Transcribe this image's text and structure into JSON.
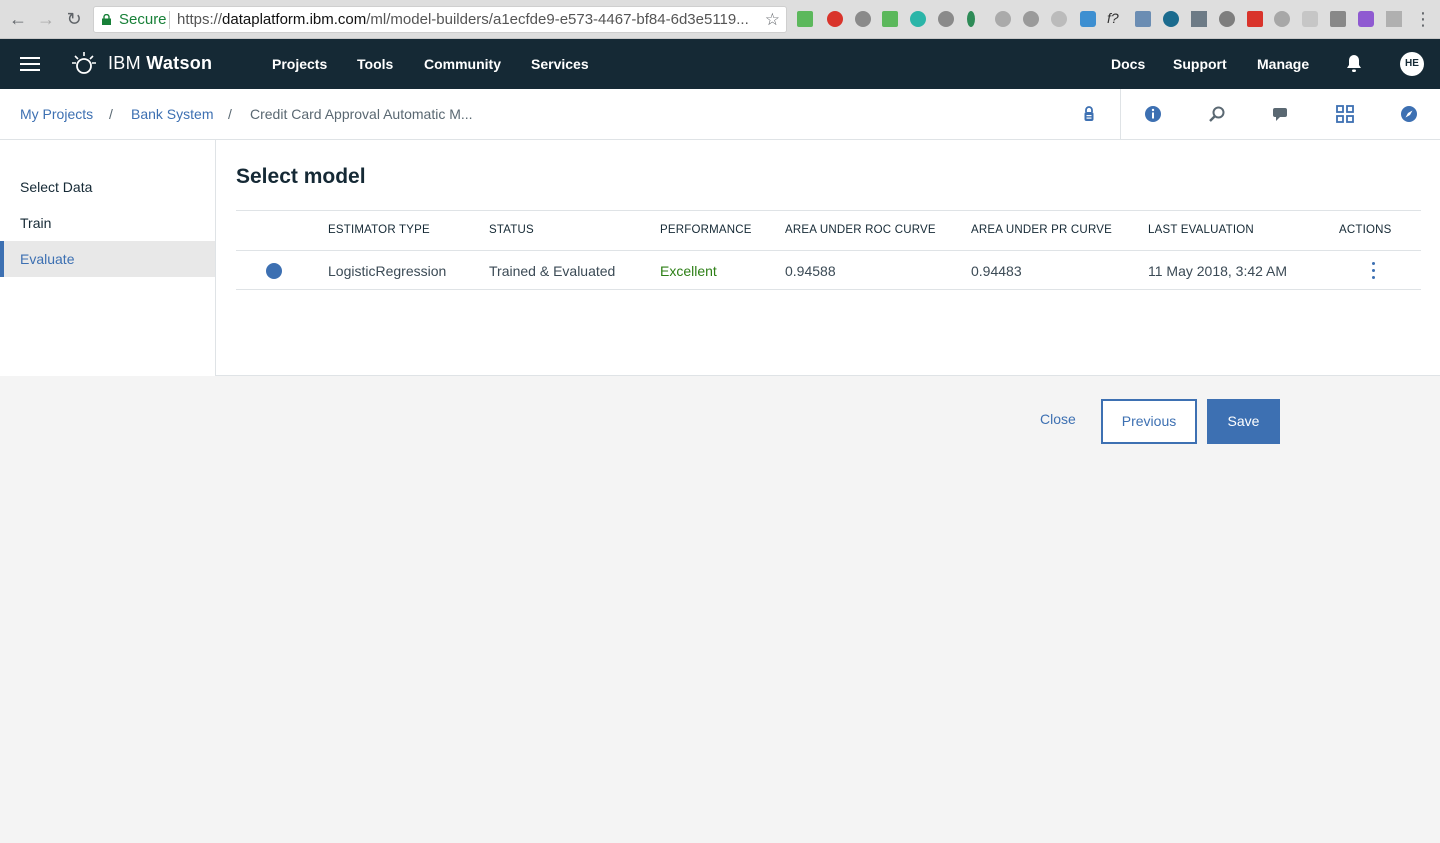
{
  "browser": {
    "secure_label": "Secure",
    "url_prefix": "https://",
    "url_host": "dataplatform.ibm.com",
    "url_path": "/ml/model-builders/a1ecfde9-e573-4467-bf84-6d3e5119..."
  },
  "topnav": {
    "brand_light": "IBM",
    "brand_bold": "Watson",
    "links": [
      "Projects",
      "Tools",
      "Community",
      "Services"
    ],
    "right_links": [
      "Docs",
      "Support",
      "Manage"
    ],
    "avatar_initials": "HE"
  },
  "breadcrumb": {
    "items": [
      "My Projects",
      "Bank System",
      "Credit Card Approval Automatic M..."
    ],
    "separator": "/"
  },
  "sidebar": {
    "items": [
      {
        "label": "Select Data",
        "active": false
      },
      {
        "label": "Train",
        "active": false
      },
      {
        "label": "Evaluate",
        "active": true
      }
    ]
  },
  "main": {
    "title": "Select model",
    "columns": [
      "ESTIMATOR TYPE",
      "STATUS",
      "PERFORMANCE",
      "AREA UNDER ROC CURVE",
      "AREA UNDER PR CURVE",
      "LAST EVALUATION",
      "ACTIONS"
    ],
    "rows": [
      {
        "estimator": "LogisticRegression",
        "status": "Trained & Evaluated",
        "performance": "Excellent",
        "roc": "0.94588",
        "pr": "0.94483",
        "last_eval": "11 May 2018, 3:42 AM"
      }
    ]
  },
  "footer": {
    "close_label": "Close",
    "previous_label": "Previous",
    "save_label": "Save"
  },
  "colors": {
    "nav_bg": "#152935",
    "accent": "#3d70b2",
    "excellent": "#2d7f16"
  }
}
